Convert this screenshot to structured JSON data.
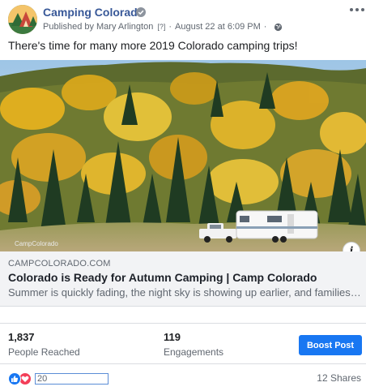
{
  "page": {
    "name": "Camping Colorado",
    "published_by_prefix": "Published by",
    "author": "Mary Arlington",
    "help_marker": "[?]",
    "separator": "·",
    "timestamp": "August 22 at 6:09 PM",
    "privacy_icon": "globe-icon"
  },
  "post": {
    "text": "There's time for many more 2019 Colorado camping trips!",
    "image_watermark": "CampColorado",
    "info_label": "i"
  },
  "link": {
    "domain": "CAMPCOLORADO.COM",
    "title": "Colorado is Ready for Autumn Camping | Camp Colorado",
    "description": "Summer is quickly fading, the night sky is showing up earlier, and families are"
  },
  "insights": {
    "reached_value": "1,837",
    "reached_label": "People Reached",
    "engagements_value": "119",
    "engagements_label": "Engagements",
    "boost_label": "Boost Post"
  },
  "footer": {
    "reaction_count": "20",
    "shares": "12 Shares",
    "reaction_icons": [
      "like-icon",
      "love-icon"
    ]
  },
  "colors": {
    "brand_link": "#385898",
    "boost_button": "#1877f2",
    "love": "#f33e58"
  }
}
